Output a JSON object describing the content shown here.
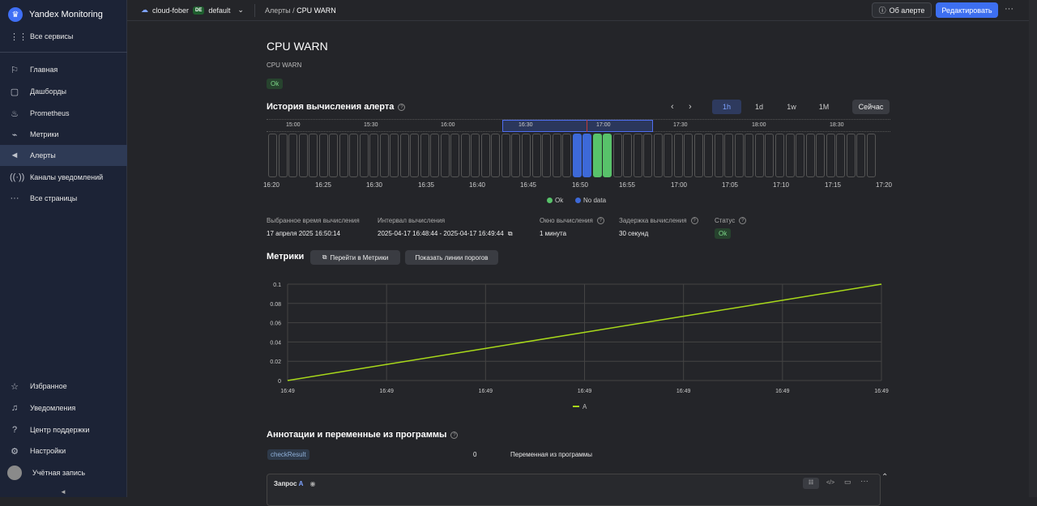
{
  "app": {
    "title": "Yandex Monitoring",
    "all_services": "Все сервисы"
  },
  "sidebar": {
    "items": [
      {
        "label": "Главная",
        "icon": "flag-icon"
      },
      {
        "label": "Дашборды",
        "icon": "dashboard-icon"
      },
      {
        "label": "Prometheus",
        "icon": "prometheus-icon"
      },
      {
        "label": "Метрики",
        "icon": "metrics-icon"
      },
      {
        "label": "Алерты",
        "icon": "megaphone-icon"
      },
      {
        "label": "Каналы уведомлений",
        "icon": "broadcast-icon"
      },
      {
        "label": "Все страницы",
        "icon": "ellipsis-icon"
      }
    ],
    "bottom": [
      {
        "label": "Избранное",
        "icon": "star-icon"
      },
      {
        "label": "Уведомления",
        "icon": "bell-icon"
      },
      {
        "label": "Центр поддержки",
        "icon": "help-icon"
      },
      {
        "label": "Настройки",
        "icon": "gear-icon"
      },
      {
        "label": "Учётная запись",
        "icon": "avatar-icon"
      }
    ]
  },
  "topbar": {
    "cloud": "cloud-fober",
    "region": "DE",
    "folder": "default",
    "crumb_parent": "Алерты",
    "crumb_sep": " / ",
    "crumb_current": "CPU WARN",
    "about": "Об алерте",
    "edit": "Редактировать"
  },
  "alert": {
    "title": "CPU WARN",
    "subtitle": "CPU WARN",
    "status": "Ok"
  },
  "history": {
    "title": "История вычисления алерта",
    "ranges": [
      "1h",
      "1d",
      "1w",
      "1M"
    ],
    "active_range": "1h",
    "now": "Сейчас",
    "timeline_labels": [
      "15:00",
      "15:30",
      "16:00",
      "16:30",
      "17:00",
      "17:30",
      "18:00",
      "18:30"
    ],
    "axis_labels": [
      "16:20",
      "16:25",
      "16:30",
      "16:35",
      "16:40",
      "16:45",
      "16:50",
      "16:55",
      "17:00",
      "17:05",
      "17:10",
      "17:15",
      "17:20"
    ],
    "legend_ok": "Ok",
    "legend_nodata": "No data",
    "colors": {
      "ok": "#58c26a",
      "nodata": "#3d69d8"
    }
  },
  "details": {
    "eval_time_label": "Выбранное время вычисления",
    "eval_time": "17 апреля 2025 16:50:14",
    "interval_label": "Интервал вычисления",
    "interval": "2025-04-17 16:48:44 - 2025-04-17 16:49:44",
    "window_label": "Окно вычисления",
    "window": "1 минута",
    "delay_label": "Задержка вычисления",
    "delay": "30 секунд",
    "status_label": "Статус",
    "status": "Ok"
  },
  "metrics": {
    "title": "Метрики",
    "go_to": "Перейти в Метрики",
    "show_thresholds": "Показать линии порогов"
  },
  "chart_data": {
    "type": "line",
    "x": [
      "16:49",
      "16:49",
      "16:49",
      "16:49",
      "16:49",
      "16:49",
      "16:49"
    ],
    "series": [
      {
        "name": "A",
        "values": [
          0,
          0.0167,
          0.0333,
          0.05,
          0.0667,
          0.0833,
          0.1
        ]
      }
    ],
    "yticks": [
      "0.1",
      "0.08",
      "0.06",
      "0.04",
      "0.02",
      "0"
    ],
    "ylim": [
      0,
      0.1
    ],
    "grid": true,
    "legend": "bottom-center",
    "color": "#a8d81a"
  },
  "annotations": {
    "title": "Аннотации и переменные из программы",
    "tag": "checkResult",
    "value": "0",
    "desc": "Переменная из программы"
  },
  "query": {
    "label": "Запрос",
    "name": "A"
  }
}
